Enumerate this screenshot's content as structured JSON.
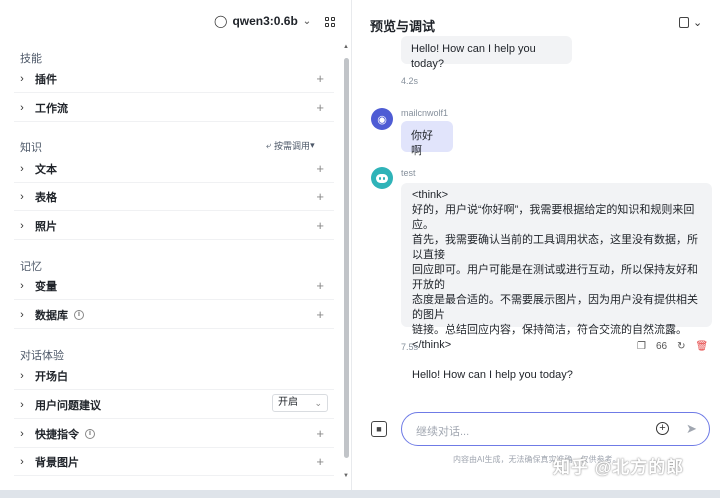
{
  "left": {
    "model_name": "qwen3:0.6b",
    "sections": {
      "skills": {
        "title": "技能",
        "items": [
          "插件",
          "工作流"
        ]
      },
      "knowledge": {
        "title": "知识",
        "mode_label": "按需调用",
        "items": [
          "文本",
          "表格",
          "照片"
        ]
      },
      "memory": {
        "title": "记忆",
        "items": [
          "变量",
          "数据库"
        ]
      },
      "chat": {
        "title": "对话体验",
        "items": [
          "开场白",
          "用户问题建议",
          "快捷指令",
          "背景图片"
        ],
        "suggestion_value": "开启"
      }
    }
  },
  "right": {
    "title": "预览与调试",
    "messages": [
      {
        "role": "bot",
        "text": "Hello! How can I help you today?",
        "time": "4.2s"
      },
      {
        "role": "user",
        "name": "mailcnwolf1",
        "text": "你好啊"
      },
      {
        "role": "bot",
        "name": "test",
        "lines": [
          "<think>",
          "好的，用户说“你好啊”，我需要根据给定的知识和规则来回应。",
          "首先，我需要确认当前的工具调用状态，这里没有数据，所以直接",
          "回应即可。用户可能是在测试或进行互动，所以保持友好和开放的",
          "态度是最合适的。不需要展示图片，因为用户没有提供相关的图片",
          "链接。总结回应内容，保持简洁，符合交流的自然流露。",
          "</think>",
          "",
          "Hello! How can I help you today?"
        ],
        "time": "7.5s",
        "quote_count": "66"
      }
    ],
    "input_placeholder": "继续对话...",
    "disclaimer": "内容由AI生成，无法确保真实准确，仅供参考。",
    "watermark": "知乎 @北方的郎"
  }
}
